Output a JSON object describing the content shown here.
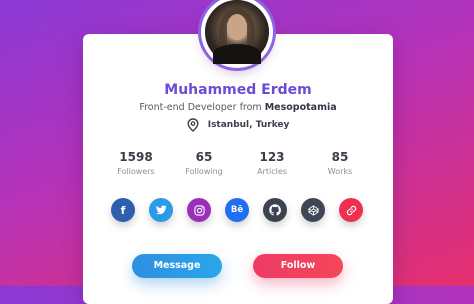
{
  "profile": {
    "name": "Muhammed Erdem",
    "role_prefix": "Front-end Developer from",
    "role_place": "Mesopotamia",
    "location": "Istanbul, Turkey"
  },
  "stats": [
    {
      "value": "1598",
      "label": "Followers"
    },
    {
      "value": "65",
      "label": "Following"
    },
    {
      "value": "123",
      "label": "Articles"
    },
    {
      "value": "85",
      "label": "Works"
    }
  ],
  "socials": [
    {
      "icon": "facebook-icon",
      "glyph": "f",
      "color": "#2d5faf"
    },
    {
      "icon": "twitter-icon",
      "glyph": "",
      "color": "#2a9be6"
    },
    {
      "icon": "instagram-icon",
      "glyph": "",
      "color": "#9b2fb8"
    },
    {
      "icon": "behance-icon",
      "glyph": "Bē",
      "color": "#1f6ff0"
    },
    {
      "icon": "github-icon",
      "glyph": "",
      "color": "#3c4250"
    },
    {
      "icon": "codepen-icon",
      "glyph": "",
      "color": "#3f4656"
    },
    {
      "icon": "link-icon",
      "glyph": "",
      "color": "#ee2f4f"
    }
  ],
  "buttons": {
    "message": "Message",
    "follow": "Follow"
  },
  "colors": {
    "accent": "#6a4cd8",
    "message_button": "#2d8fe0",
    "follow_button": "#ef3a64"
  }
}
